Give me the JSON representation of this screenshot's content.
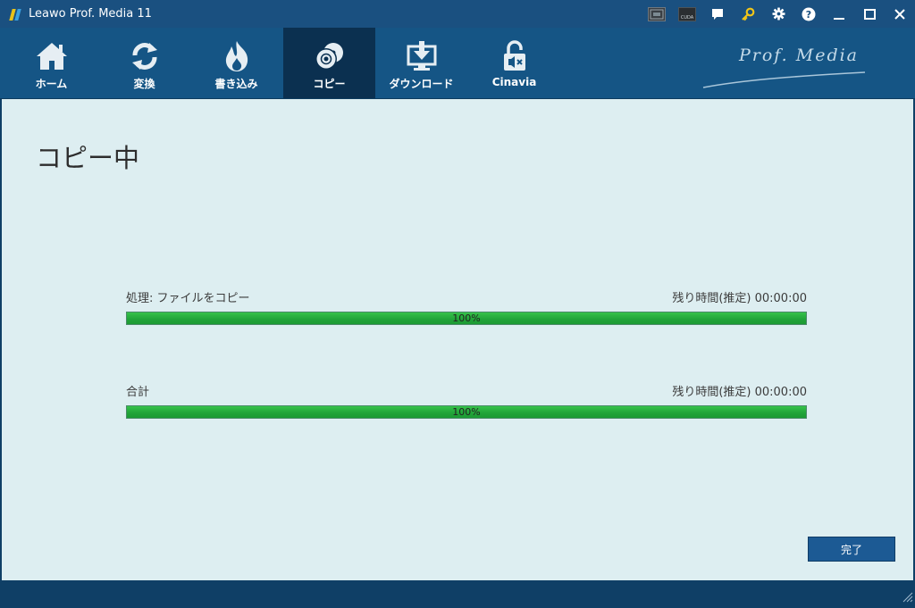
{
  "window": {
    "title": "Leawo Prof. Media 11",
    "controls": {
      "gpu": "gpu-acceleration-icon",
      "cuda": "cuda-icon",
      "cuda_text": "CUDA",
      "feedback": "chat-icon",
      "register": "key-icon",
      "settings": "gear-icon",
      "help": "help-icon",
      "minimize": "minimize-icon",
      "maximize": "maximize-icon",
      "close": "close-icon"
    }
  },
  "nav": {
    "tabs": [
      {
        "label": "ホーム",
        "icon": "home-icon",
        "active": false
      },
      {
        "label": "変換",
        "icon": "convert-icon",
        "active": false
      },
      {
        "label": "書き込み",
        "icon": "burn-icon",
        "active": false
      },
      {
        "label": "コピー",
        "icon": "copy-disc-icon",
        "active": true
      },
      {
        "label": "ダウンロード",
        "icon": "download-icon",
        "active": false
      },
      {
        "label": "Cinavia",
        "icon": "cinavia-icon",
        "active": false
      }
    ],
    "brand": "Prof. Media"
  },
  "main": {
    "title": "コピー中",
    "process": {
      "label": "処理: ファイルをコピー",
      "time_label": "残り時間(推定) 00:00:00",
      "progress": 100,
      "progress_text": "100%"
    },
    "total": {
      "label": "合計",
      "time_label": "残り時間(推定) 00:00:00",
      "progress": 100,
      "progress_text": "100%"
    },
    "done_button": "完了"
  },
  "colors": {
    "titlebar": "#1a5080",
    "navbar": "#155585",
    "active_tab": "#0b3050",
    "content_bg": "#ddeef1",
    "progress_green": "#22a53a",
    "button": "#1c5a94",
    "key_icon": "#f0c419"
  }
}
